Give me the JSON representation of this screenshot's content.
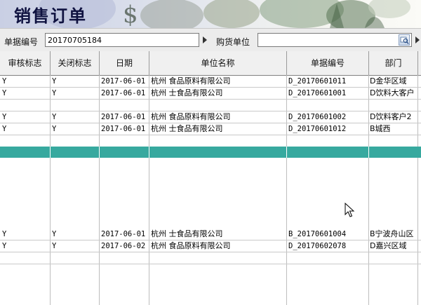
{
  "window": {
    "title": "销售订单"
  },
  "filters": {
    "order_no_label": "单据编号",
    "order_no_value": "20170705184",
    "purchaser_label": "购货单位",
    "purchaser_value": ""
  },
  "table": {
    "columns": [
      "审核标志",
      "关闭标志",
      "日期",
      "单位名称",
      "单据编号",
      "部门"
    ],
    "rows": [
      {
        "audit": "Y",
        "closed": "Y",
        "date": "2017-06-01",
        "unit": "杭州  食品原料有限公司",
        "doc_no": "D_20170601011",
        "dept": "D金华区域"
      },
      {
        "audit": "Y",
        "closed": "Y",
        "date": "2017-06-01",
        "unit": "杭州  士食品有限公司",
        "doc_no": "D_20170601001",
        "dept": "D饮料大客户"
      },
      {
        "audit": "Y",
        "closed": "Y",
        "date": "2017-06-01",
        "unit": "杭州  食品原料有限公司",
        "doc_no": "D_20170601002",
        "dept": "D饮料客户2"
      },
      {
        "audit": "Y",
        "closed": "Y",
        "date": "2017-06-01",
        "unit": "杭州  士食品有限公司",
        "doc_no": "D_20170601012",
        "dept": "B城西"
      },
      {
        "audit": "Y",
        "closed": "Y",
        "date": "2017-06-01",
        "unit": "杭州  士食品有限公司",
        "doc_no": "B_20170601004",
        "dept": "B宁波舟山区"
      },
      {
        "audit": "Y",
        "closed": "Y",
        "date": "2017-06-02",
        "unit": "杭州  食品原料有限公司",
        "doc_no": "D_20170602078",
        "dept": "D嘉兴区域"
      }
    ]
  },
  "icons": {
    "arrow": "play-triangle-icon",
    "lookup": "lookup-icon",
    "cursor": "mouse-pointer-icon"
  },
  "colors": {
    "selected_row": "#37a99f",
    "header_bg": "#f0f0f0",
    "title_text": "#0f1240"
  }
}
